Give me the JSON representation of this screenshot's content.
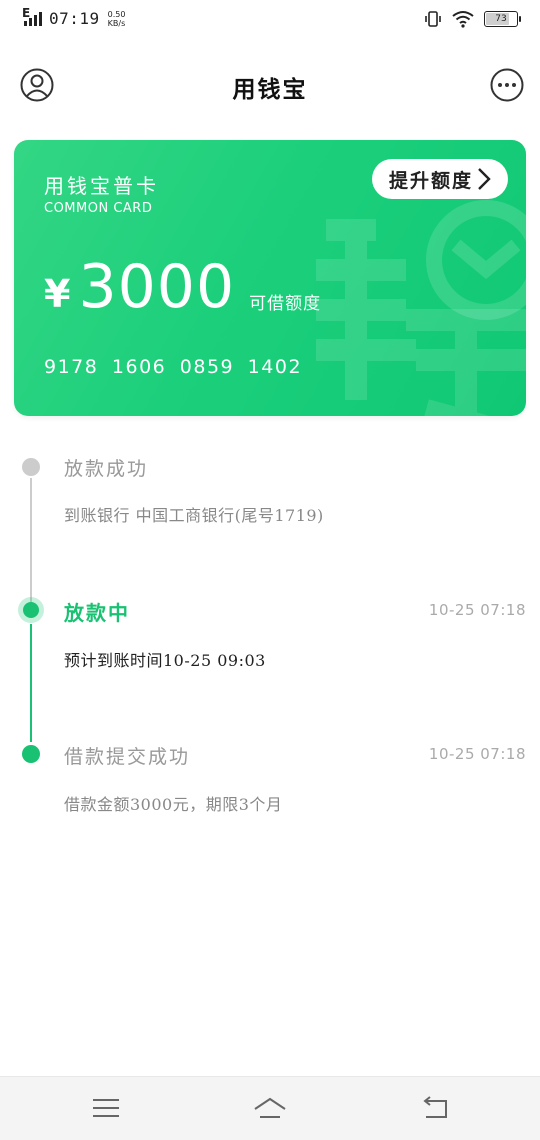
{
  "status_bar": {
    "network": "E",
    "time": "07:19",
    "speed_value": "0.50",
    "speed_unit": "KB/s",
    "battery": "73",
    "icons": [
      "signal-icon",
      "vibrate-icon",
      "wifi-icon",
      "battery-icon"
    ]
  },
  "nav": {
    "title": "用钱宝",
    "left_icon": "avatar-icon",
    "right_icon": "more-icon"
  },
  "card": {
    "name": "用钱宝普卡",
    "subtitle": "COMMON CARD",
    "upgrade_label": "提升额度",
    "currency": "¥",
    "amount": "3000",
    "amount_label": "可借额度",
    "card_number": "9178 1606 0859 1402",
    "colors": {
      "start": "#33d684",
      "end": "#10c874"
    }
  },
  "timeline": {
    "steps": [
      {
        "title": "放款成功",
        "description": "到账银行 中国工商银行(尾号1719)",
        "time": "",
        "state": "pending"
      },
      {
        "title": "放款中",
        "description": "预计到账时间10-25 09:03",
        "time": "10-25 07:18",
        "state": "active"
      },
      {
        "title": "借款提交成功",
        "description": "借款金额3000元，期限3个月",
        "time": "10-25 07:18",
        "state": "done"
      }
    ],
    "colors": {
      "active": "#19c272",
      "inactive": "#cccccc"
    }
  },
  "bottom_bar": {
    "icons": [
      "menu-icon",
      "home-icon",
      "back-icon"
    ]
  }
}
